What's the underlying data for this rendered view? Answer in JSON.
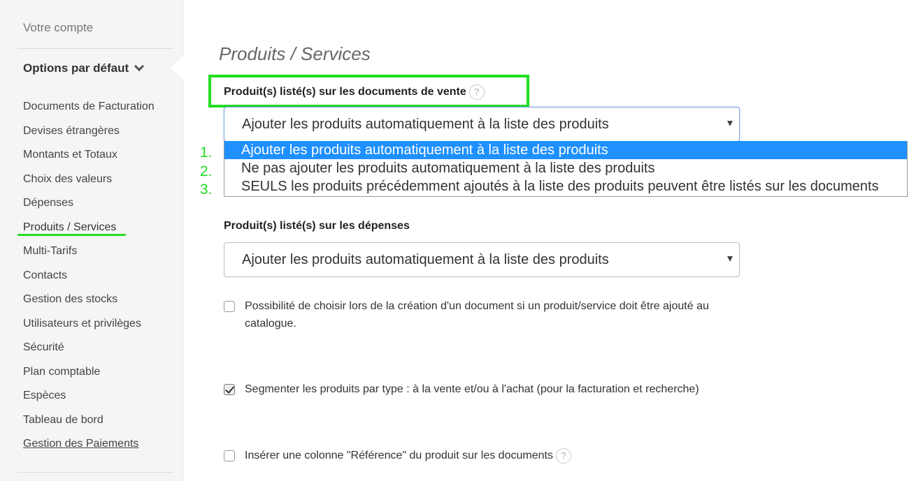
{
  "sidebar": {
    "account": "Votre compte",
    "options_title": "Options par défaut",
    "items": [
      {
        "label": "Documents de Facturation"
      },
      {
        "label": "Devises étrangères"
      },
      {
        "label": "Montants et Totaux"
      },
      {
        "label": "Choix des valeurs"
      },
      {
        "label": "Dépenses"
      },
      {
        "label": "Produits / Services"
      },
      {
        "label": "Multi-Tarifs"
      },
      {
        "label": "Contacts"
      },
      {
        "label": "Gestion des stocks"
      },
      {
        "label": "Utilisateurs et privilèges"
      },
      {
        "label": "Sécurité"
      },
      {
        "label": "Plan comptable"
      },
      {
        "label": "Espèces"
      },
      {
        "label": "Tableau de bord"
      },
      {
        "label": "Gestion des Paiements"
      }
    ]
  },
  "main": {
    "title": "Produits / Services",
    "sales_field": {
      "label": "Produit(s) listé(s) sur les documents de vente",
      "help": "?",
      "value": "Ajouter les produits automatiquement à la liste des produits",
      "options": [
        "Ajouter les produits automatiquement à la liste des produits",
        "Ne pas ajouter les produits automatiquement à la liste des produits",
        "SEULS les produits précédemment ajoutés à la liste des produits peuvent être listés sur les documents"
      ],
      "annotations": [
        "1.",
        "2.",
        "3."
      ]
    },
    "expenses_field": {
      "label": "Produit(s) listé(s) sur les dépenses",
      "value": "Ajouter les produits automatiquement à la liste des produits"
    },
    "checkboxes": [
      {
        "text": "Possibilité de choisir lors de la création d'un document si un produit/service doit être ajouté au catalogue.",
        "checked": false
      },
      {
        "text": "Segmenter les produits par type : à la vente et/ou à l'achat (pour la facturation et recherche)",
        "checked": true
      },
      {
        "text": "Insérer une colonne \"Référence\" du produit sur les documents",
        "checked": false,
        "help": "?"
      }
    ]
  },
  "colors": {
    "annotation_green": "#22dd22",
    "selected_option": "#1e90ff"
  }
}
